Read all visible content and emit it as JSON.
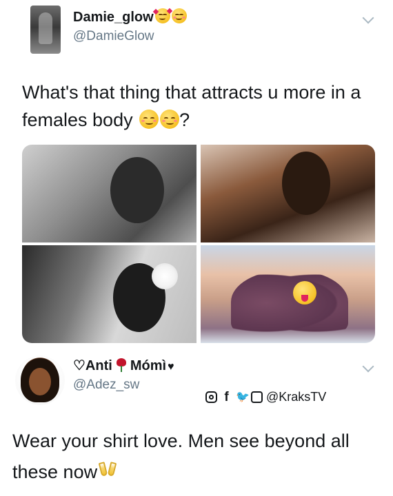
{
  "tweet1": {
    "display_name": "Damie_glow",
    "handle": "@DamieGlow",
    "text": "What's that thing that attracts u more in a females body",
    "text_suffix": "?",
    "name_emojis": [
      "smiling-face-with-hearts",
      "smiling-face"
    ],
    "text_emojis": [
      "relieved-face",
      "relieved-face"
    ],
    "media": [
      "photo-1",
      "photo-2",
      "photo-3",
      "photo-4"
    ]
  },
  "tweet2": {
    "display_name_prefix": "♡Anti",
    "display_name_suffix": "Mómì",
    "heart": "♥",
    "handle": "@Adez_sw",
    "watermark": "@KraksTV",
    "text": "Wear your shirt love. Men see beyond all these now",
    "text_emoji": "clinking-glasses"
  },
  "icons": {
    "chevron": "chevron-down-icon",
    "instagram": "instagram-icon",
    "facebook": "facebook-icon",
    "twitter": "twitter-icon",
    "youtube": "youtube-icon"
  },
  "colors": {
    "text": "#14171a",
    "secondary": "#657786",
    "chevron": "#aab8c2",
    "emoji_yellow": "#f6c125",
    "rose": "#c2152c"
  }
}
